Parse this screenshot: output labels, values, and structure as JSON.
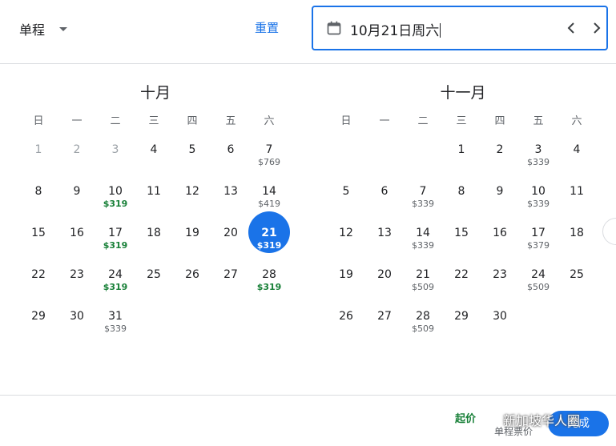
{
  "header": {
    "trip_type": "单程",
    "reset_label": "重置",
    "date_value": "10月21日周六"
  },
  "weekdays": [
    "日",
    "一",
    "二",
    "三",
    "四",
    "五",
    "六"
  ],
  "months": [
    {
      "title": "十月",
      "offset": 0,
      "days": [
        {
          "d": "1",
          "p": "",
          "past": true
        },
        {
          "d": "2",
          "p": "",
          "past": true
        },
        {
          "d": "3",
          "p": "",
          "past": true
        },
        {
          "d": "4",
          "p": ""
        },
        {
          "d": "5",
          "p": ""
        },
        {
          "d": "6",
          "p": ""
        },
        {
          "d": "7",
          "p": "$769"
        },
        {
          "d": "8",
          "p": ""
        },
        {
          "d": "9",
          "p": ""
        },
        {
          "d": "10",
          "p": "$319",
          "low": true
        },
        {
          "d": "11",
          "p": ""
        },
        {
          "d": "12",
          "p": ""
        },
        {
          "d": "13",
          "p": ""
        },
        {
          "d": "14",
          "p": "$419"
        },
        {
          "d": "15",
          "p": ""
        },
        {
          "d": "16",
          "p": ""
        },
        {
          "d": "17",
          "p": "$319",
          "low": true
        },
        {
          "d": "18",
          "p": ""
        },
        {
          "d": "19",
          "p": ""
        },
        {
          "d": "20",
          "p": ""
        },
        {
          "d": "21",
          "p": "$319",
          "low": true,
          "selected": true
        },
        {
          "d": "22",
          "p": ""
        },
        {
          "d": "23",
          "p": ""
        },
        {
          "d": "24",
          "p": "$319",
          "low": true
        },
        {
          "d": "25",
          "p": ""
        },
        {
          "d": "26",
          "p": ""
        },
        {
          "d": "27",
          "p": ""
        },
        {
          "d": "28",
          "p": "$319",
          "low": true
        },
        {
          "d": "29",
          "p": ""
        },
        {
          "d": "30",
          "p": ""
        },
        {
          "d": "31",
          "p": "$339"
        }
      ]
    },
    {
      "title": "十一月",
      "offset": 3,
      "days": [
        {
          "d": "1",
          "p": ""
        },
        {
          "d": "2",
          "p": ""
        },
        {
          "d": "3",
          "p": "$339"
        },
        {
          "d": "4",
          "p": ""
        },
        {
          "d": "5",
          "p": ""
        },
        {
          "d": "6",
          "p": ""
        },
        {
          "d": "7",
          "p": "$339"
        },
        {
          "d": "8",
          "p": ""
        },
        {
          "d": "9",
          "p": ""
        },
        {
          "d": "10",
          "p": "$339"
        },
        {
          "d": "11",
          "p": ""
        },
        {
          "d": "12",
          "p": ""
        },
        {
          "d": "13",
          "p": ""
        },
        {
          "d": "14",
          "p": "$339"
        },
        {
          "d": "15",
          "p": ""
        },
        {
          "d": "16",
          "p": ""
        },
        {
          "d": "17",
          "p": "$379"
        },
        {
          "d": "18",
          "p": ""
        },
        {
          "d": "19",
          "p": ""
        },
        {
          "d": "20",
          "p": ""
        },
        {
          "d": "21",
          "p": "$509"
        },
        {
          "d": "22",
          "p": ""
        },
        {
          "d": "23",
          "p": ""
        },
        {
          "d": "24",
          "p": "$509"
        },
        {
          "d": "25",
          "p": ""
        },
        {
          "d": "26",
          "p": ""
        },
        {
          "d": "27",
          "p": ""
        },
        {
          "d": "28",
          "p": "$509"
        },
        {
          "d": "29",
          "p": ""
        },
        {
          "d": "30",
          "p": ""
        }
      ]
    }
  ],
  "footer": {
    "price_from": "起价",
    "price_sub": "单程票价",
    "done_label": "完成",
    "watermark": "新加坡华人圈"
  },
  "colors": {
    "accent": "#1a73e8",
    "low_price": "#188038",
    "muted": "#5f6368"
  },
  "icons": {
    "calendar": "calendar-icon",
    "prev": "chevron-left-icon",
    "next": "chevron-right-icon",
    "dropdown": "caret-down-icon"
  }
}
